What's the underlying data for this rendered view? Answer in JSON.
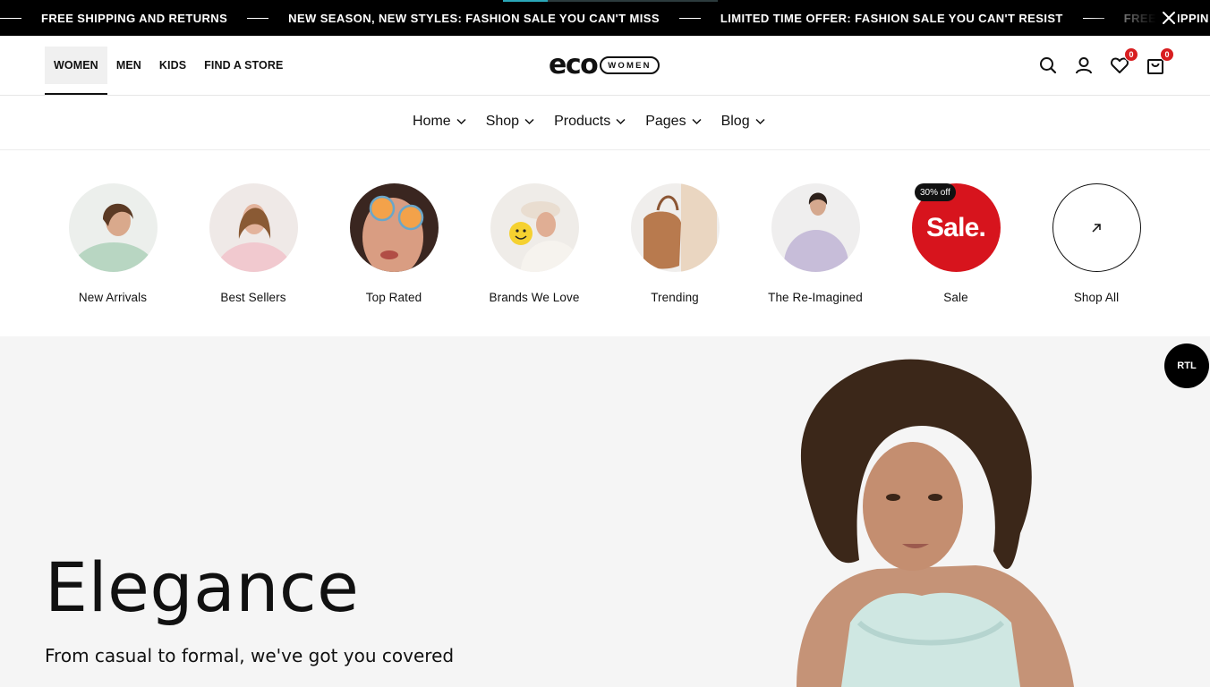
{
  "announcement": {
    "items": [
      "FREE SHIPPING AND RETURNS",
      "NEW SEASON, NEW STYLES: FASHION SALE YOU CAN'T MISS",
      "LIMITED TIME OFFER: FASHION SALE YOU CAN'T RESIST",
      "FREE SHIPPIN"
    ],
    "close_icon": "close-icon"
  },
  "header": {
    "gender_nav": [
      "WOMEN",
      "MEN",
      "KIDS",
      "FIND A STORE"
    ],
    "active": "WOMEN",
    "logo": {
      "mark": "eco",
      "badge": "WOMEN"
    },
    "icons": [
      "search-icon",
      "user-icon",
      "heart-icon",
      "bag-icon"
    ],
    "wishlist_count": "0",
    "cart_count": "0"
  },
  "mainnav": {
    "items": [
      "Home",
      "Shop",
      "Products",
      "Pages",
      "Blog"
    ]
  },
  "categories": {
    "items": [
      "New Arrivals",
      "Best Sellers",
      "Top Rated",
      "Brands We Love",
      "Trending",
      "The Re-Imagined",
      "Sale",
      "Shop All"
    ],
    "sale_circle_text": "Sale.",
    "sale_pill": "30% off"
  },
  "hero": {
    "title": "Elegance",
    "subtitle": "From casual to formal, we've got you covered"
  },
  "rtl_button": "RTL",
  "colors": {
    "accent_red": "#d7141d",
    "badge_red": "#d81e20",
    "announcement_bg": "#000000",
    "hero_bg": "#f5f5f5"
  }
}
